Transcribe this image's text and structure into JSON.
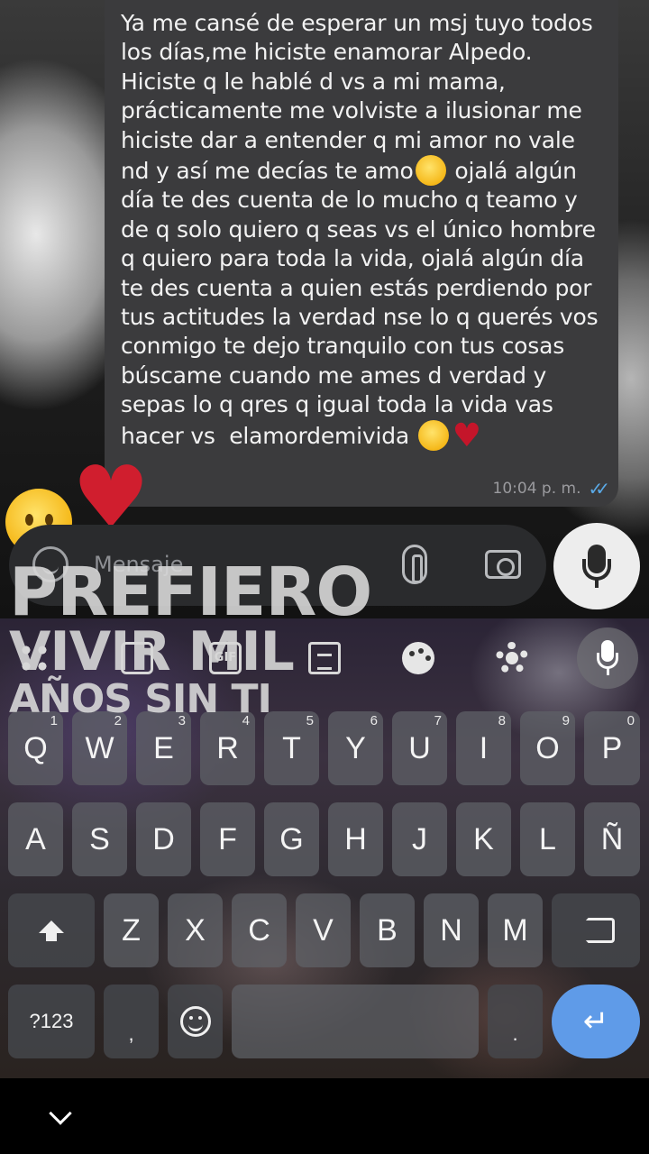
{
  "message": {
    "text_before_emoji1": "Ya me cansé de esperar un msj tuyo todos\nlos días,me hiciste enamorar Alpedo.\nHiciste q le hablé d vs a mi mama,\nprácticamente me volviste a ilusionar me\nhiciste dar a entender q mi amor no vale\nnd y así me decías te amo",
    "text_middle": " ojalá algún\ndía te des cuenta de lo mucho q teamo y\nde q solo quiero q seas vs el único hombre\nq quiero para toda la vida, ojalá algún día\nte des cuenta a quien estás perdiendo por\ntus actitudes la verdad nse lo q querés vos\nconmigo te dejo tranquilo con tus cosas\nbúscame cuando me ames d verdad y\nsepas lo q qres q igual toda la vida vas\nhacer vs  elamordemivida ",
    "time": "10:04 p. m.",
    "read_ticks": "✓✓",
    "emoji_melting": "melting-face-emoji",
    "emoji_sleeping": "sleeping-face-emoji",
    "emoji_broken_heart": "broken-heart-emoji"
  },
  "stickers": [
    "melting-face-emoji",
    "broken-heart-emoji"
  ],
  "compose": {
    "placeholder": "Mensaje"
  },
  "overlay_caption": {
    "line1": "PREFIERO",
    "line2": "VIVIR MIL",
    "line3": "AÑOS SIN TI"
  },
  "keyboard": {
    "toolbar": {
      "gif_label": "GIF"
    },
    "row1": [
      {
        "label": "Q",
        "hint": "1"
      },
      {
        "label": "W",
        "hint": "2"
      },
      {
        "label": "E",
        "hint": "3"
      },
      {
        "label": "R",
        "hint": "4"
      },
      {
        "label": "T",
        "hint": "5"
      },
      {
        "label": "Y",
        "hint": "6"
      },
      {
        "label": "U",
        "hint": "7"
      },
      {
        "label": "I",
        "hint": "8"
      },
      {
        "label": "O",
        "hint": "9"
      },
      {
        "label": "P",
        "hint": "0"
      }
    ],
    "row2": [
      "A",
      "S",
      "D",
      "F",
      "G",
      "H",
      "J",
      "K",
      "L",
      "Ñ"
    ],
    "row3": [
      "Z",
      "X",
      "C",
      "V",
      "B",
      "N",
      "M"
    ],
    "symbols_label": "?123",
    "comma_label": ",",
    "period_label": ".",
    "enter_symbol": "↵"
  },
  "colors": {
    "bubble": "#3b3b3d",
    "read_ticks": "#5aa9e6",
    "enter_key": "#5f9be8"
  }
}
